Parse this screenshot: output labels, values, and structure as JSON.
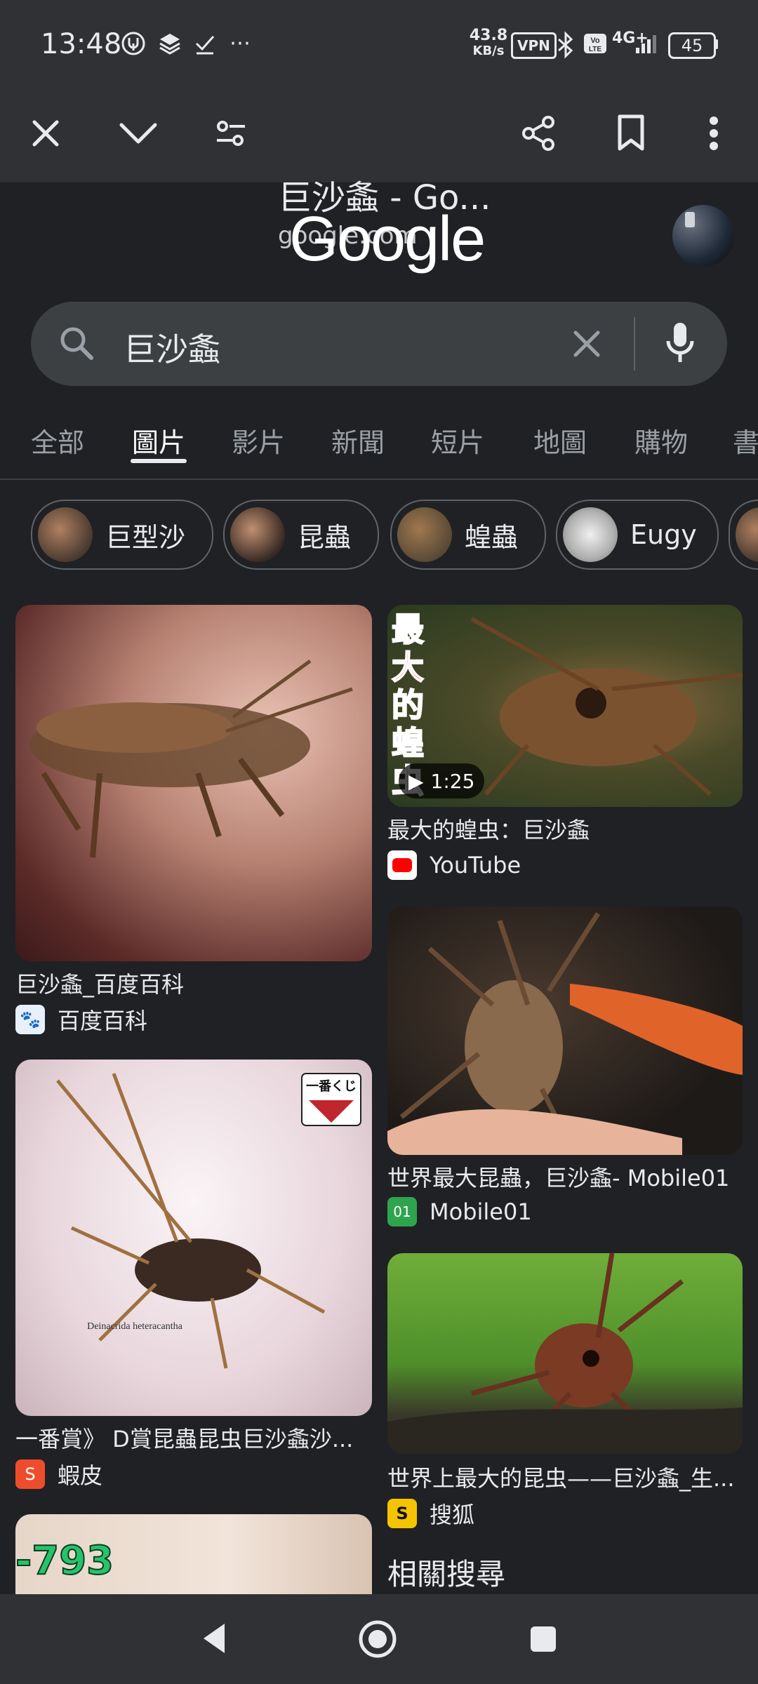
{
  "status": {
    "time": "13:48",
    "speed_value": "43.8",
    "speed_unit": "KB/s",
    "vpn": "VPN",
    "network": "4G+",
    "battery": "45"
  },
  "tab": {
    "title": "巨沙螽 - Go...",
    "url": "google.com"
  },
  "logo": "Google",
  "search": {
    "query": "巨沙螽"
  },
  "tabs": {
    "items": [
      "全部",
      "圖片",
      "影片",
      "新聞",
      "短片",
      "地圖",
      "購物",
      "書"
    ]
  },
  "chips": {
    "items": [
      "巨型沙",
      "昆蟲",
      "蝗蟲",
      "Eugy"
    ]
  },
  "results": {
    "left": [
      {
        "caption": "巨沙螽_百度百科",
        "source": "百度百科"
      },
      {
        "caption": "一番賞》 D賞昆蟲昆虫巨沙螽沙...",
        "source": "蝦皮",
        "overlay_top": "一番くじ",
        "watermark": "Deinacrida heteracantha"
      },
      {
        "overlay": "-793"
      }
    ],
    "right": [
      {
        "caption": "最大的蝗虫：巨沙螽",
        "source": "YouTube",
        "duration": "1:25",
        "overlay": "最大的蝗虫"
      },
      {
        "caption": "世界最大昆蟲，巨沙螽- Mobile01",
        "source": "Mobile01"
      },
      {
        "caption": "世界上最大的昆虫——巨沙螽_生...",
        "source": "搜狐"
      }
    ]
  },
  "related": "相關搜尋"
}
